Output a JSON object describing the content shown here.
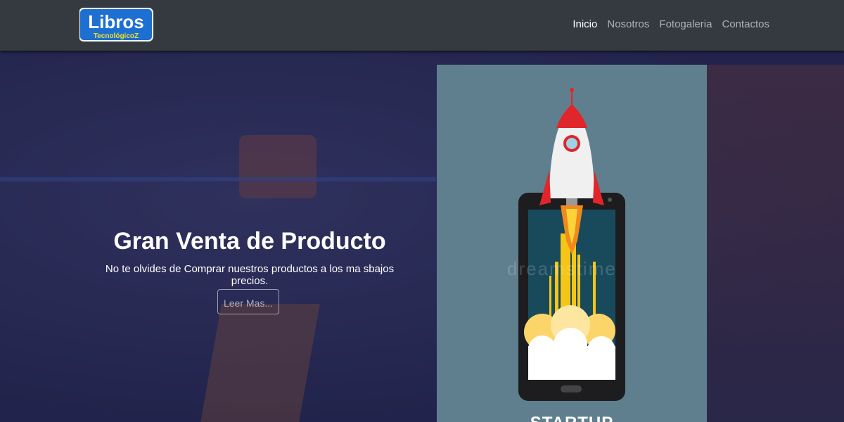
{
  "brand": {
    "name": "Libros",
    "tagline": "TecnológicoZ"
  },
  "nav": {
    "items": [
      "Inicio",
      "Nosotros",
      "Fotogaleria",
      "Contactos"
    ],
    "active_index": 0
  },
  "hero": {
    "title": "Gran Venta de Producto",
    "subtitle": "No te olvides de Comprar nuestros productos a los ma sbajos precios.",
    "button_label": "Leer Mas..."
  },
  "promo": {
    "watermark": "dreamstime",
    "caption": "STARTUP"
  },
  "colors": {
    "navbar": "#343a40",
    "promo_bg": "#5f7f8e",
    "brand_blue": "#1d6fd1",
    "rocket_red": "#e0262a"
  }
}
